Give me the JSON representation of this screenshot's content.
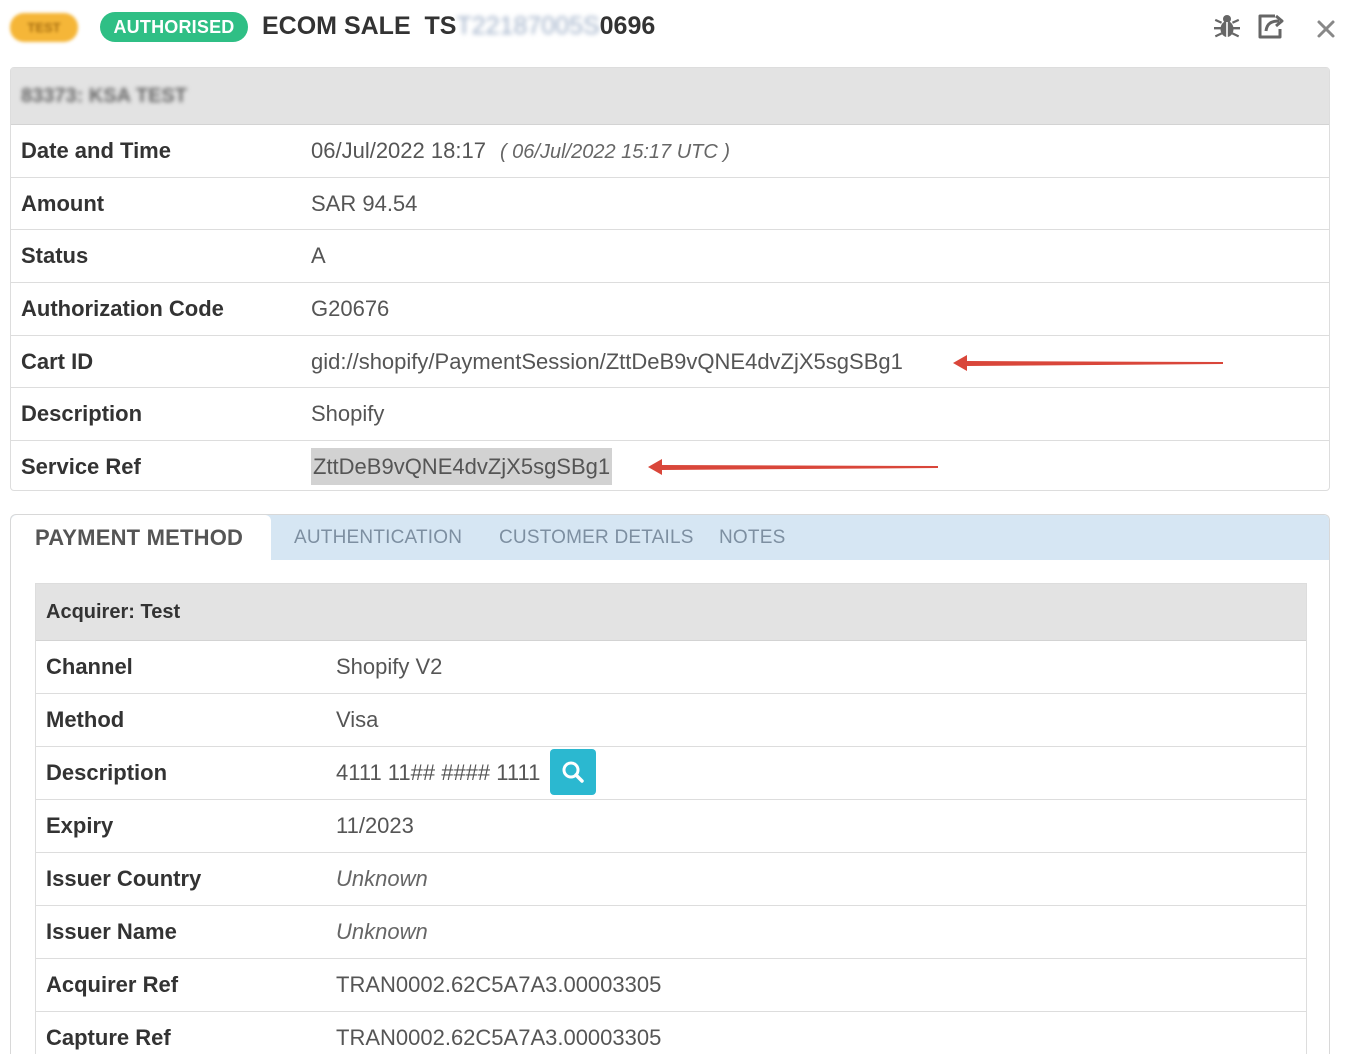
{
  "header": {
    "test_badge": "TEST",
    "status_badge": "AUTHORISED",
    "title_prefix": "ECOM SALE  TS",
    "title_masked": "T22187005S",
    "title_suffix": "0696",
    "icons": [
      "bug-icon",
      "share-icon",
      "close-icon"
    ]
  },
  "transaction": {
    "merchant": "83373: KSA TEST",
    "rows": [
      {
        "label": "Date and Time",
        "value": "06/Jul/2022 18:17",
        "extra": "( 06/Jul/2022 15:17 UTC )"
      },
      {
        "label": "Amount",
        "value": "SAR 94.54"
      },
      {
        "label": "Status",
        "value": "A"
      },
      {
        "label": "Authorization Code",
        "value": "G20676"
      },
      {
        "label": "Cart ID",
        "value": "gid://shopify/PaymentSession/ZttDeB9vQNE4dvZjX5sgSBg1"
      },
      {
        "label": "Description",
        "value": "Shopify"
      },
      {
        "label": "Service Ref",
        "value": "ZttDeB9vQNE4dvZjX5sgSBg1"
      }
    ]
  },
  "tabs": [
    {
      "label": "PAYMENT METHOD",
      "active": true
    },
    {
      "label": "AUTHENTICATION",
      "active": false
    },
    {
      "label": "CUSTOMER DETAILS",
      "active": false
    },
    {
      "label": "NOTES",
      "active": false
    }
  ],
  "payment": {
    "acquirer": "Acquirer: Test",
    "rows": [
      {
        "label": "Channel",
        "value": "Shopify V2"
      },
      {
        "label": "Method",
        "value": "Visa"
      },
      {
        "label": "Description",
        "value": "4111 11## #### 1111"
      },
      {
        "label": "Expiry",
        "value": "11/2023"
      },
      {
        "label": "Issuer Country",
        "value": "Unknown"
      },
      {
        "label": "Issuer Name",
        "value": "Unknown"
      },
      {
        "label": "Acquirer Ref",
        "value": "TRAN0002.62C5A7A3.00003305"
      },
      {
        "label": "Capture Ref",
        "value": "TRAN0002.62C5A7A3.00003305"
      }
    ]
  },
  "colors": {
    "authorised": "#2fbf85",
    "test": "#f5b638",
    "tabbar": "#d6e6f3",
    "search_button": "#2bb8d0",
    "annotation_arrow": "#d9463a"
  }
}
